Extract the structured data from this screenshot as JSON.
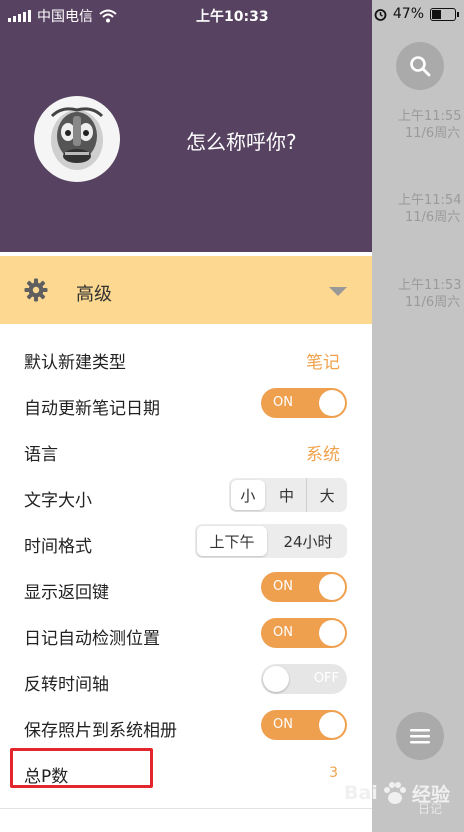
{
  "status_bar": {
    "carrier": "中国电信",
    "time": "上午10:33",
    "battery": "47%"
  },
  "header": {
    "greeting": "怎么称呼你?"
  },
  "advanced": {
    "label": "高级"
  },
  "settings": {
    "default_type": {
      "label": "默认新建类型",
      "value": "笔记"
    },
    "auto_update_date": {
      "label": "自动更新笔记日期",
      "toggle": "ON"
    },
    "language": {
      "label": "语言",
      "value": "系统"
    },
    "text_size": {
      "label": "文字大小",
      "options": [
        "小",
        "中",
        "大"
      ]
    },
    "time_format": {
      "label": "时间格式",
      "options": [
        "上下午",
        "24小时"
      ]
    },
    "show_back": {
      "label": "显示返回键",
      "toggle": "ON"
    },
    "diary_location": {
      "label": "日记自动检测位置",
      "toggle": "ON"
    },
    "reverse_timeline": {
      "label": "反转时间轴",
      "toggle": "OFF"
    },
    "save_photos": {
      "label": "保存照片到系统相册",
      "toggle": "ON"
    },
    "total_p": {
      "label": "总P数",
      "value": "3"
    }
  },
  "entries": [
    {
      "time": "上午11:55",
      "date": "11/6周六"
    },
    {
      "time": "上午11:54",
      "date": "11/6周六"
    },
    {
      "time": "上午11:53",
      "date": "11/6周六"
    }
  ],
  "watermark": {
    "brand": "经验",
    "caption": "日记"
  },
  "colors": {
    "header": "#574261",
    "advanced_bar": "#fcd891",
    "accent": "#efa04f",
    "highlight": "#e3262d"
  }
}
